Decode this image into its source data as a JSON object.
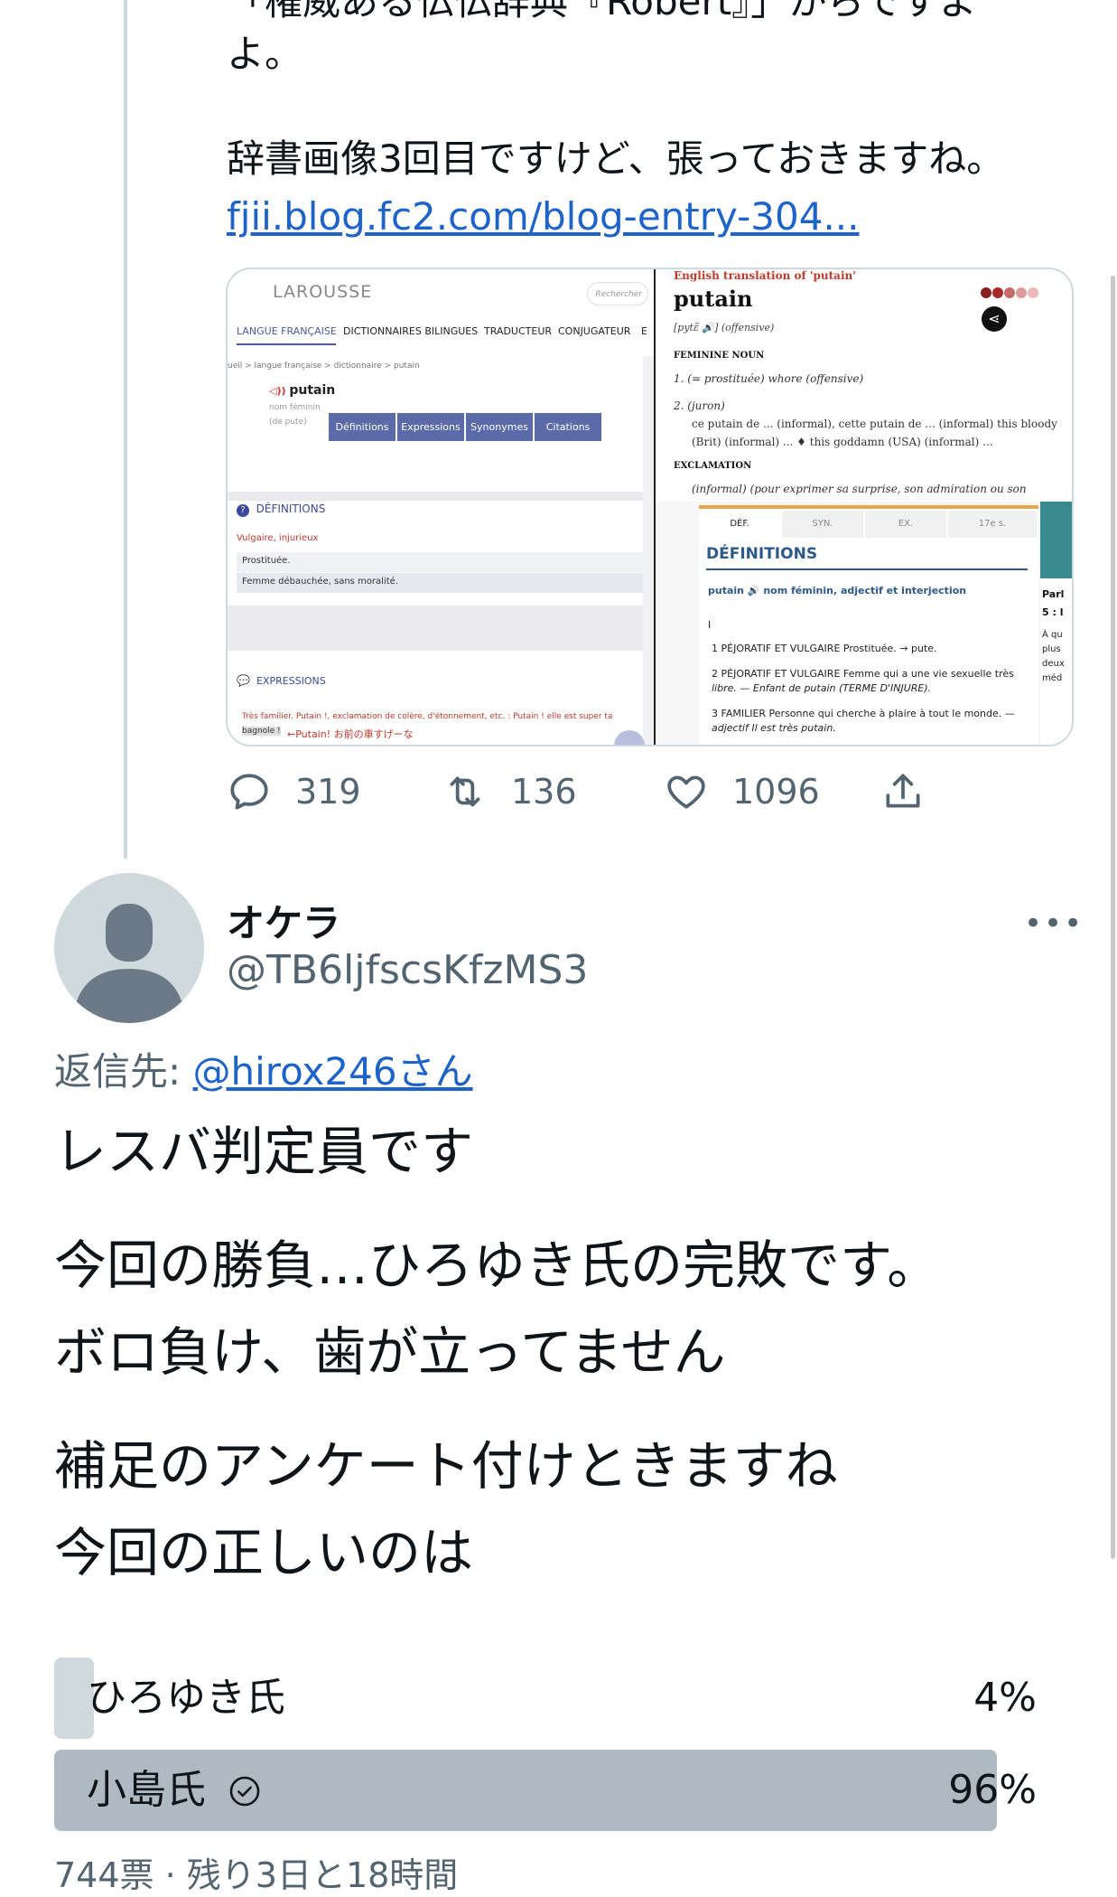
{
  "tweet_top": {
    "line1": "「権威ある仏仏辞典『Robert』」からですよ",
    "line2": "よ。",
    "line3": "辞書画像3回目ですけど、張っておきますね。",
    "link": "fjii.blog.fc2.com/blog-entry-304...",
    "media": {
      "larousse": {
        "brand": "LAROUSSE",
        "search": "Rechercher",
        "nav": [
          "LANGUE FRANÇAISE",
          "DICTIONNAIRES BILINGUES",
          "TRADUCTEUR",
          "CONJUGATEUR",
          "E"
        ],
        "breadcrumb": "ueil > langue française > dictionnaire > putain",
        "word": "putain",
        "pos": "nom féminin",
        "origin": "(de pute)",
        "tabs": [
          "Définitions",
          "Expressions",
          "Synonymes",
          "Citations"
        ],
        "defs_heading": "DÉFINITIONS",
        "register": "Vulgaire, injurieux",
        "def1": "Prostituée.",
        "def2": "Femme débauchée, sans moralité.",
        "expr_heading": "EXPRESSIONS",
        "expr_line1": "Très familier. Putain !, exclamation de colère, d'étonnement, etc. : Putain ! elle est super ta",
        "expr_line2": "bagnole !",
        "annotation": "←Putain! お前の車すげーな"
      },
      "collins": {
        "header": "English translation of 'putain'",
        "word": "putain",
        "pron": "[pytɛ̃ 🔊] (offensive)",
        "sec1": "FEMININE NOUN",
        "l1": "1.  (= prostituée) whore (offensive)",
        "l2": "2.  (juron)",
        "l3": "ce putain de ... (informal), cette putain de ... (informal) this bloody",
        "l4": "(Brit) (informal) ... ♦ this goddamn (USA) (informal) ...",
        "sec2": "EXCLAMATION",
        "l5": "(informal) (pour exprimer sa surprise, son admiration ou son"
      },
      "robert": {
        "tabs": [
          "DÉF.",
          "SYN.",
          "EX.",
          "17e s."
        ],
        "heading": "DÉFINITIONS",
        "word_line": "putain 🔊 nom féminin, adjectif et interjection",
        "roman": "I",
        "d1": "1 PÉJORATIF ET VULGAIRE Prostituée. → pute.",
        "d2a": "2 PÉJORATIF ET VULGAIRE Femme qui a une vie sexuelle très",
        "d2b": "libre. — Enfant de putain (TERME D'INJURE).",
        "d3a": "3 FAMILIER Personne qui cherche à plaire à tout le monde. —",
        "d3b": "adjectif Il est très putain.",
        "side": [
          "Parl",
          "5 : l",
          "À qu",
          "plus",
          "deux",
          "méd"
        ]
      }
    },
    "actions": {
      "reply": "319",
      "retweet": "136",
      "like": "1096"
    }
  },
  "tweet": {
    "name": "オケラ",
    "handle": "@TB6ljfscsKfzMS3",
    "more": "•••",
    "reply_prefix": "返信先: ",
    "reply_user": "@hirox246さん",
    "lines": [
      "レスバ判定員です",
      "今回の勝負…ひろゆき氏の完敗です。",
      "ボロ負け、歯が立ってません",
      "補足のアンケート付けときますね",
      "今回の正しいのは"
    ],
    "poll": {
      "options": [
        {
          "label": "ひろゆき氏",
          "percent": "4%",
          "fraction": 0.04
        },
        {
          "label": "小島氏",
          "percent": "96%",
          "fraction": 0.96,
          "winner": true
        }
      ],
      "meta": "744票 · 残り3日と18時間"
    }
  }
}
